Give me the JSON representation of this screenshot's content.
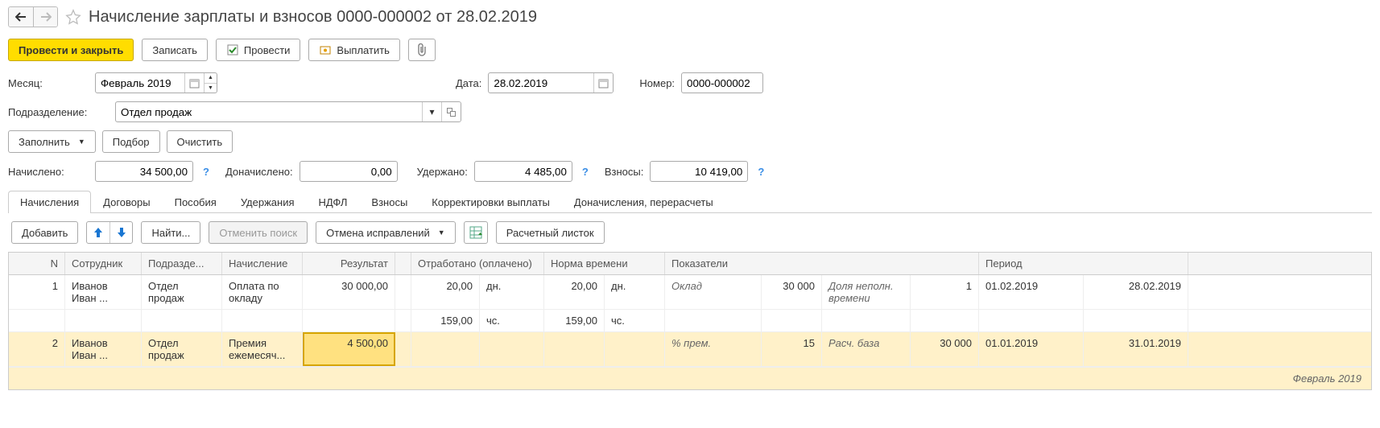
{
  "header": {
    "title": "Начисление зарплаты и взносов 0000-000002 от 28.02.2019"
  },
  "toolbar": {
    "post_close": "Провести и закрыть",
    "save": "Записать",
    "post": "Провести",
    "pay": "Выплатить"
  },
  "form": {
    "month_label": "Месяц:",
    "month_value": "Февраль 2019",
    "date_label": "Дата:",
    "date_value": "28.02.2019",
    "number_label": "Номер:",
    "number_value": "0000-000002",
    "dept_label": "Подразделение:",
    "dept_value": "Отдел продаж"
  },
  "actions": {
    "fill": "Заполнить",
    "pick": "Подбор",
    "clear": "Очистить"
  },
  "totals": {
    "accrued_label": "Начислено:",
    "accrued_value": "34 500,00",
    "extra_label": "Доначислено:",
    "extra_value": "0,00",
    "withheld_label": "Удержано:",
    "withheld_value": "4 485,00",
    "contrib_label": "Взносы:",
    "contrib_value": "10 419,00"
  },
  "tabs": [
    "Начисления",
    "Договоры",
    "Пособия",
    "Удержания",
    "НДФЛ",
    "Взносы",
    "Корректировки выплаты",
    "Доначисления, перерасчеты"
  ],
  "tabToolbar": {
    "add": "Добавить",
    "find": "Найти...",
    "cancel_find": "Отменить поиск",
    "cancel_fix": "Отмена исправлений",
    "payslip": "Расчетный листок"
  },
  "cols": {
    "n": "N",
    "emp": "Сотрудник",
    "dept": "Подразде...",
    "acc": "Начисление",
    "res": "Результат",
    "worked": "Отработано (оплачено)",
    "norm": "Норма времени",
    "ind": "Показатели",
    "period": "Период"
  },
  "rows": [
    {
      "n": "1",
      "emp": "Иванов Иван ...",
      "dept": "Отдел продаж",
      "acc": "Оплата по окладу",
      "res": "30 000,00",
      "work_d": "20,00",
      "work_du": "дн.",
      "work_h": "159,00",
      "work_hu": "чс.",
      "norm_d": "20,00",
      "norm_du": "дн.",
      "norm_h": "159,00",
      "norm_hu": "чс.",
      "ind1l": "Оклад",
      "ind1v": "30 000",
      "ind2l": "Доля неполн. времени",
      "ind2v": "1",
      "p1": "01.02.2019",
      "p2": "28.02.2019"
    },
    {
      "n": "2",
      "emp": "Иванов Иван ...",
      "dept": "Отдел продаж",
      "acc": "Премия ежемесяч...",
      "res": "4 500,00",
      "work_d": "",
      "work_du": "",
      "work_h": "",
      "work_hu": "",
      "norm_d": "",
      "norm_du": "",
      "norm_h": "",
      "norm_hu": "",
      "ind1l": "% прем.",
      "ind1v": "15",
      "ind2l": "Расч. база",
      "ind2v": "30 000",
      "p1": "01.01.2019",
      "p2": "31.01.2019"
    }
  ],
  "footer_period": "Февраль 2019"
}
